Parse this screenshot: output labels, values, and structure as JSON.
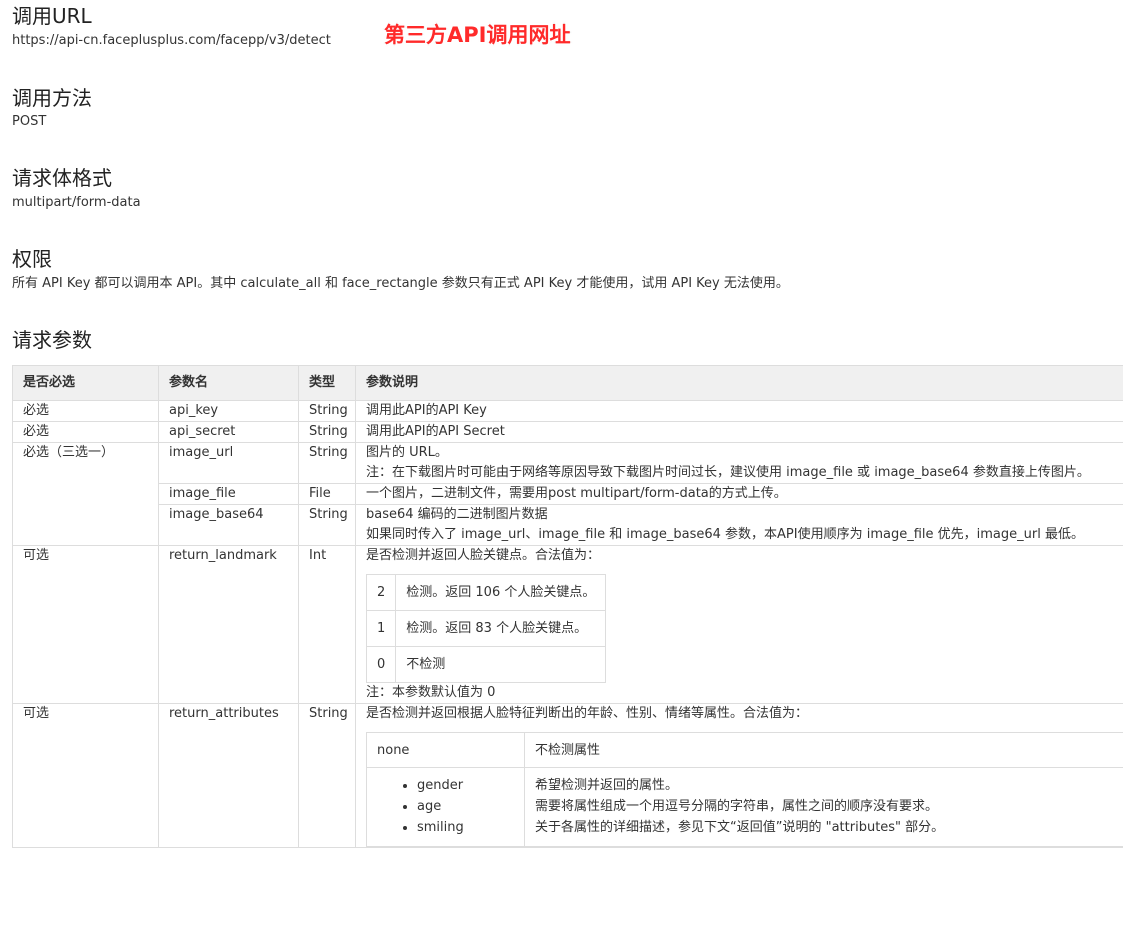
{
  "sections": {
    "url": {
      "title": "调用URL",
      "text": "https://api-cn.faceplusplus.com/facepp/v3/detect"
    },
    "method": {
      "title": "调用方法",
      "text": "POST"
    },
    "format": {
      "title": "请求体格式",
      "text": "multipart/form-data"
    },
    "permission": {
      "title": "权限",
      "text": "所有 API Key 都可以调用本 API。其中 calculate_all 和 face_rectangle 参数只有正式 API Key 才能使用，试用 API Key 无法使用。"
    },
    "params_title": "请求参数"
  },
  "annotation": "第三方API调用网址",
  "table": {
    "headers": [
      "是否必选",
      "参数名",
      "类型",
      "参数说明"
    ],
    "rows": [
      {
        "required": "必选",
        "name": "api_key",
        "type": "String",
        "desc": [
          "调用此API的API Key"
        ]
      },
      {
        "required": "必选",
        "name": "api_secret",
        "type": "String",
        "desc": [
          "调用此API的API Secret"
        ]
      },
      {
        "required": "必选（三选一）",
        "name": "image_url",
        "type": "String",
        "desc": [
          "图片的 URL。",
          "注：在下载图片时可能由于网络等原因导致下载图片时间过长，建议使用 image_file 或 image_base64 参数直接上传图片。"
        ]
      },
      {
        "name": "image_file",
        "type": "File",
        "desc": [
          "一个图片，二进制文件，需要用post multipart/form-data的方式上传。"
        ]
      },
      {
        "name": "image_base64",
        "type": "String",
        "desc": [
          "base64 编码的二进制图片数据",
          "如果同时传入了 image_url、image_file 和 image_base64 参数，本API使用顺序为 image_file 优先，image_url 最低。"
        ]
      },
      {
        "required": "可选",
        "name": "return_landmark",
        "type": "Int",
        "desc": [
          "是否检测并返回人脸关键点。合法值为："
        ],
        "values": [
          {
            "value": "2",
            "label": "检测。返回 106 个人脸关键点。"
          },
          {
            "value": "1",
            "label": "检测。返回 83 个人脸关键点。"
          },
          {
            "value": "0",
            "label": "不检测"
          }
        ],
        "note": "注：本参数默认值为 0"
      },
      {
        "required": "可选",
        "name": "return_attributes",
        "type": "String",
        "desc": [
          "是否检测并返回根据人脸特征判断出的年龄、性别、情绪等属性。合法值为："
        ],
        "values": [
          {
            "value": "none",
            "label": [
              "不检测属性"
            ]
          },
          {
            "items": [
              "gender",
              "age",
              "smiling"
            ],
            "label": [
              "希望检测并返回的属性。",
              "需要将属性组成一个用逗号分隔的字符串，属性之间的顺序没有要求。",
              "关于各属性的详细描述，参见下文“返回值”说明的 \"attributes\" 部分。"
            ]
          }
        ]
      }
    ]
  }
}
